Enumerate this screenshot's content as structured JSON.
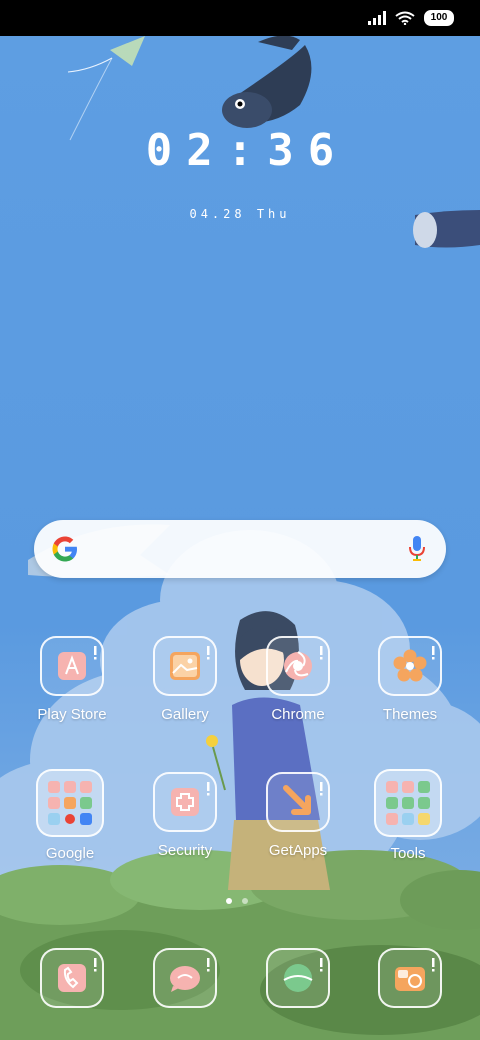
{
  "status_bar": {
    "battery": "100",
    "icons": [
      "signal-icon",
      "wifi-icon",
      "battery-icon"
    ]
  },
  "clock": {
    "time": "02:36",
    "date": "04.28  Thu"
  },
  "search": {
    "icons": [
      "google-g-icon",
      "microphone-icon"
    ]
  },
  "apps": [
    {
      "label": "Play Store",
      "icon": "play-store-icon"
    },
    {
      "label": "Gallery",
      "icon": "gallery-icon"
    },
    {
      "label": "Chrome",
      "icon": "chrome-icon"
    },
    {
      "label": "Themes",
      "icon": "themes-icon"
    },
    {
      "label": "Google",
      "icon": "google-folder-icon"
    },
    {
      "label": "Security",
      "icon": "security-icon"
    },
    {
      "label": "GetApps",
      "icon": "getapps-icon"
    },
    {
      "label": "Tools",
      "icon": "tools-folder-icon"
    }
  ],
  "dock": [
    {
      "icon": "phone-icon"
    },
    {
      "icon": "messages-icon"
    },
    {
      "icon": "browser-icon"
    },
    {
      "icon": "camera-icon"
    }
  ],
  "page_indicator": {
    "pages": 2,
    "current": 1
  },
  "colors": {
    "sky": "#5b9be0",
    "accent_pink": "#f6b3b0",
    "accent_orange": "#f5a55e",
    "accent_green": "#7bc98d"
  }
}
